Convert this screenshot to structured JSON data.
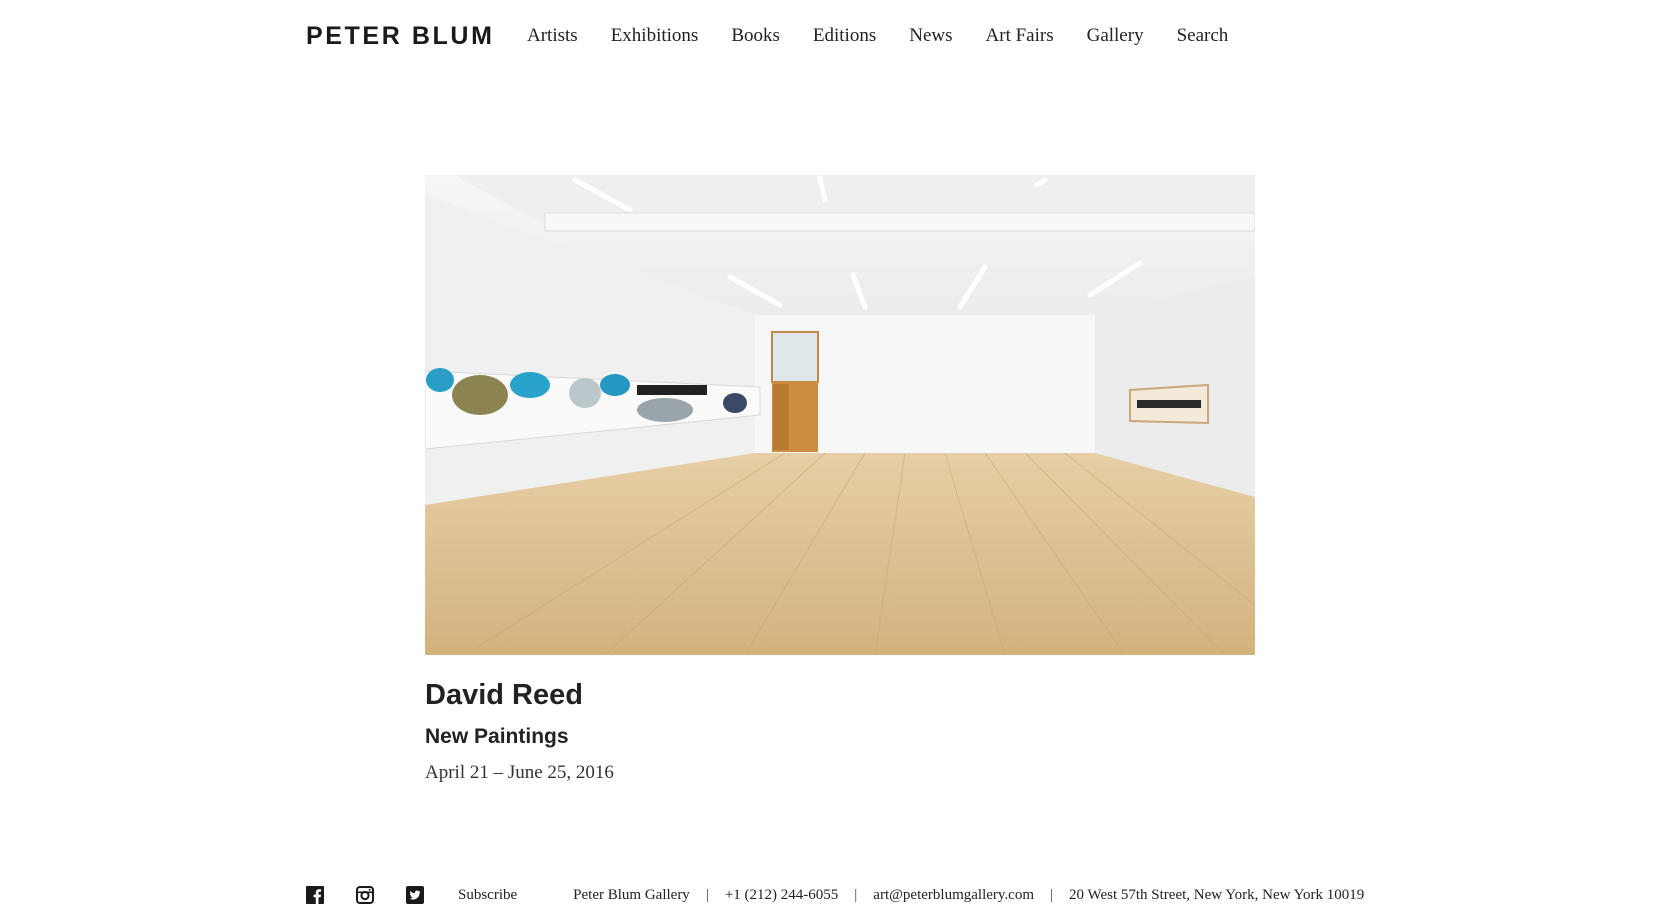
{
  "header": {
    "logo": "PETER BLUM",
    "nav": [
      "Artists",
      "Exhibitions",
      "Books",
      "Editions",
      "News",
      "Art Fairs",
      "Gallery",
      "Search"
    ]
  },
  "exhibition": {
    "artist": "David Reed",
    "title": "New Paintings",
    "dates": "April 21 – June 25, 2016"
  },
  "footer": {
    "social": [
      "facebook-icon",
      "instagram-icon",
      "twitter-icon"
    ],
    "subscribe": "Subscribe",
    "gallery_name": "Peter Blum Gallery",
    "phone": "+1 (212) 244-6055",
    "email": "art@peterblumgallery.com",
    "address": "20 West 57th Street, New York, New York 10019",
    "separator": "|"
  }
}
